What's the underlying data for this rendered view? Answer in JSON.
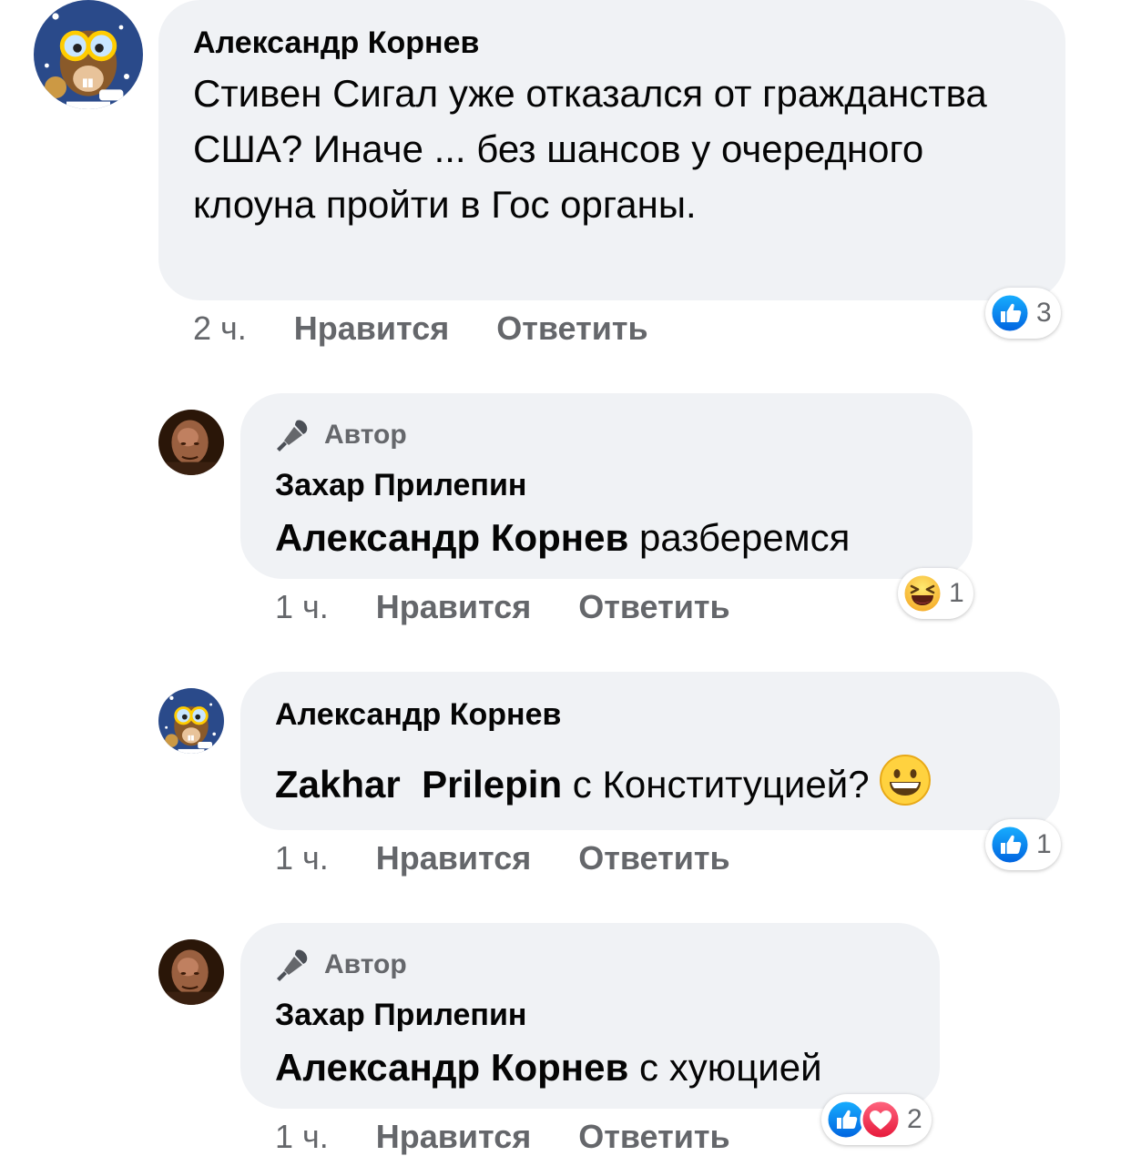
{
  "comments": [
    {
      "author": "Александр Корнев",
      "text": "Стивен Сигал уже отказался от гражданства США? Иначе ... без шансов у очередного клоуна пройти в Гос органы.",
      "time": "2 ч.",
      "like_label": "Нравится",
      "reply_label": "Ответить",
      "reaction_count": "3",
      "reactions": [
        "like-icon"
      ]
    },
    {
      "badge": "Автор",
      "author": "Захар Прилепин",
      "mention": "Александр Корнев",
      "text": " разберемся",
      "time": "1 ч.",
      "like_label": "Нравится",
      "reply_label": "Ответить",
      "reaction_count": "1",
      "reactions": [
        "haha-icon"
      ]
    },
    {
      "author": "Александр Корнев",
      "mention": "Zakhar  Prilepin",
      "text": " с Конституцией?",
      "emoji": "grinning-emoji",
      "time": "1 ч.",
      "like_label": "Нравится",
      "reply_label": "Ответить",
      "reaction_count": "1",
      "reactions": [
        "like-icon"
      ]
    },
    {
      "badge": "Автор",
      "author": "Захар Прилепин",
      "mention": "Александр Корнев",
      "text": " с хуюцией",
      "time": "1 ч.",
      "like_label": "Нравится",
      "reply_label": "Ответить",
      "reaction_count": "2",
      "reactions": [
        "like-icon",
        "love-icon"
      ]
    }
  ],
  "colors": {
    "bubble": "#f0f2f5",
    "meta_text": "#65676b",
    "like_blue": "#1877f2",
    "love_red": "#f33e58"
  }
}
